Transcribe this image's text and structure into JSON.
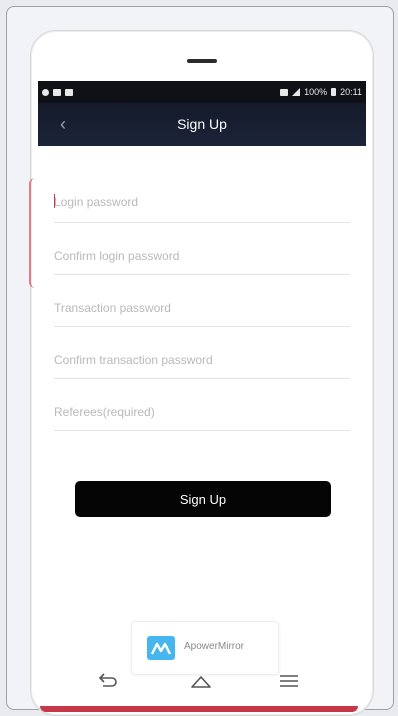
{
  "status_bar": {
    "battery": "100%",
    "time": "20:11"
  },
  "app_bar": {
    "title": "Sign Up",
    "back_icon": "chevron-left-icon"
  },
  "form": {
    "fields": [
      {
        "placeholder": "Login password",
        "value": ""
      },
      {
        "placeholder": "Confirm login password",
        "value": ""
      },
      {
        "placeholder": "Transaction password",
        "value": ""
      },
      {
        "placeholder": "Confirm transaction password",
        "value": ""
      },
      {
        "placeholder": "Referees(required)",
        "value": ""
      }
    ],
    "submit_label": "Sign Up"
  },
  "watermark": {
    "text": "ApowerMirror"
  },
  "nav": {
    "back_icon": "back-arrow-icon",
    "home_icon": "home-icon",
    "menu_icon": "menu-icon"
  },
  "colors": {
    "app_bar": "#141a2a",
    "button": "#050505",
    "accent": "#d0374a"
  }
}
